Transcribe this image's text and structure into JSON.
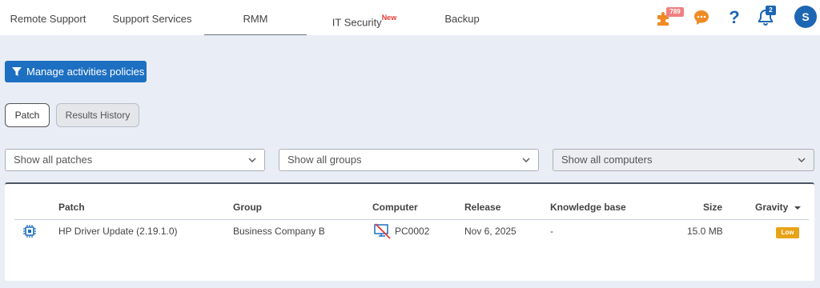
{
  "nav": {
    "tabs": [
      {
        "label": "Remote Support"
      },
      {
        "label": "Support Services"
      },
      {
        "label": "RMM"
      },
      {
        "label": "IT Security",
        "badge": "New"
      },
      {
        "label": "Backup"
      }
    ],
    "active_tab": "RMM",
    "icons": {
      "puzzle": {
        "name": "puzzle-icon",
        "badge": "789",
        "color": "#f08a24",
        "badge_color": "#f08080"
      },
      "chat": {
        "name": "chat-icon",
        "color": "#f08a24"
      },
      "help": {
        "name": "help-icon",
        "label": "?",
        "color": "#1d66b3"
      },
      "bell": {
        "name": "bell-icon",
        "badge": "2",
        "color": "#1d66b3"
      }
    },
    "avatar_initial": "S"
  },
  "toolbar": {
    "manage_policies_label": "Manage activities policies"
  },
  "subtabs": {
    "patch_label": "Patch",
    "history_label": "Results History"
  },
  "filters": {
    "patches": "Show all patches",
    "groups": "Show all groups",
    "computers": "Show all computers"
  },
  "table": {
    "headers": {
      "patch": "Patch",
      "group": "Group",
      "computer": "Computer",
      "release": "Release",
      "kb": "Knowledge base",
      "size": "Size",
      "gravity": "Gravity"
    },
    "rows": [
      {
        "patch": "HP Driver Update (2.19.1.0)",
        "group": "Business Company B",
        "computer": "PC0002",
        "release": "Nov 6, 2025",
        "kb": "-",
        "size": "15.0 MB",
        "gravity": "Low"
      }
    ]
  },
  "colors": {
    "primary": "#1d6fc1",
    "gravity_low": "#e8a317",
    "new_badge": "#e53935"
  }
}
